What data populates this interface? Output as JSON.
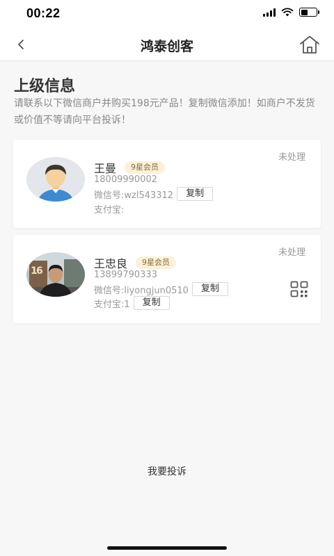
{
  "status_bar": {
    "time": "00:22"
  },
  "nav": {
    "title": "鸿泰创客"
  },
  "section": {
    "title": "上级信息",
    "notice": "请联系以下微信商户并购买198元产品！复制微信添加！如商户不发货或价值不等请向平台投诉！"
  },
  "cards": [
    {
      "status": "未处理",
      "name": "王曼",
      "badge": "9星会员",
      "phone": "18009990002",
      "wechat": "微信号:wzl543312",
      "copy_label": "复制",
      "alipay": "支付宝:"
    },
    {
      "status": "未处理",
      "name": "王忠良",
      "badge": "9星会员",
      "phone": "13899790333",
      "wechat": "微信号:liyongjun0510",
      "wechat_copy_label": "复制",
      "alipay": "支付宝:1",
      "alipay_copy_label": "复制"
    }
  ],
  "footer": {
    "complain_label": "我要投诉"
  },
  "colors": {
    "badge_bg": "#fbf1da",
    "badge_text": "#8a6a35",
    "background": "#f7f7f7"
  }
}
